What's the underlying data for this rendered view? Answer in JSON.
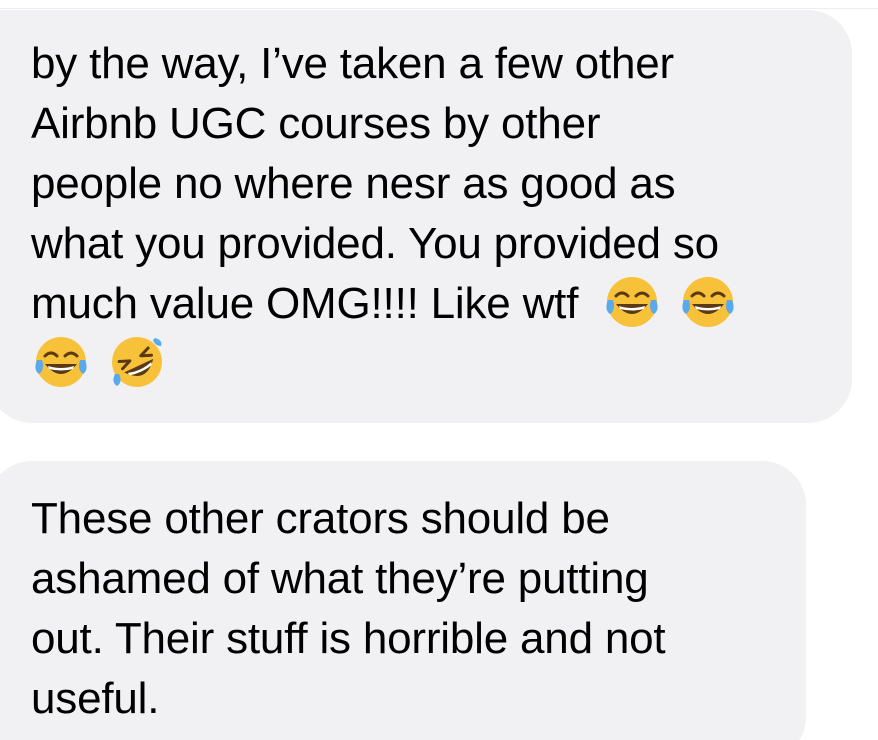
{
  "messages": [
    {
      "lines": [
        "by the way, I’ve taken a few other",
        "Airbnb UGC courses by other",
        "people no where nesr as good as",
        "what you provided. You provided so",
        "much value OMG!!!! Like wtf"
      ],
      "trailing_emojis_line5": [
        "face-with-tears-of-joy",
        "face-with-tears-of-joy"
      ],
      "emoji_line": [
        "face-with-tears-of-joy",
        "rolling-on-the-floor-laughing"
      ]
    },
    {
      "lines": [
        "These other crators should be",
        "ashamed of what they’re putting",
        "out. Their stuff is horrible and not",
        "useful."
      ]
    }
  ],
  "colors": {
    "bubble_background": "#f1f1f4",
    "text": "#000000",
    "emoji_face": "#f7c23a",
    "emoji_tear": "#5aa9ea"
  }
}
